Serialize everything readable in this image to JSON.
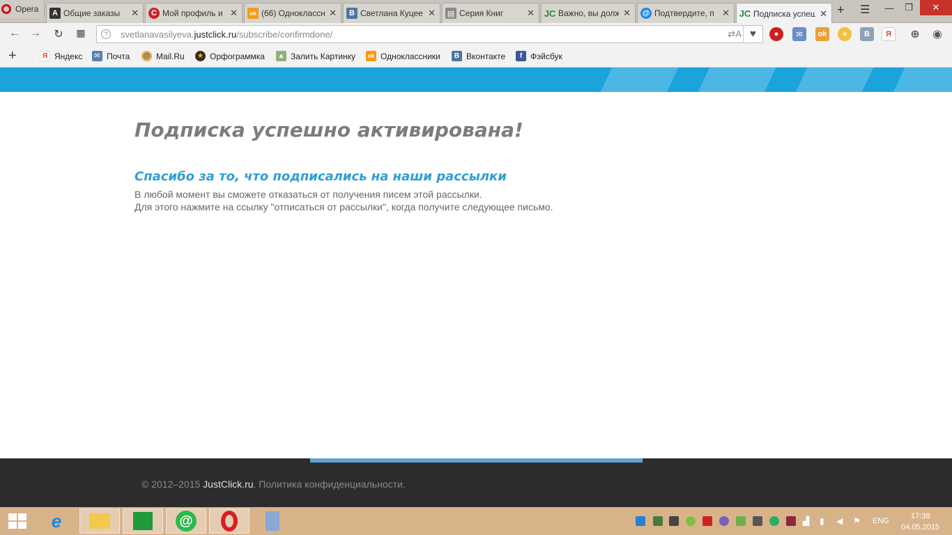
{
  "browser": {
    "menu_label": "Opera",
    "tabs": [
      {
        "title": "Общие заказы",
        "icon_text": "A",
        "icon_color": "#333333"
      },
      {
        "title": "Мой профиль и",
        "icon_text": "С",
        "icon_color": "#cc2222"
      },
      {
        "title": "(66) Одноклассн",
        "icon_text": "ok",
        "icon_color": "#f39c12"
      },
      {
        "title": "Светлана Куцее",
        "icon_text": "B",
        "icon_color": "#4c75a3"
      },
      {
        "title": "Серия Книг",
        "icon_text": "▤",
        "icon_color": "#888888"
      },
      {
        "title": "Важно, вы долж",
        "icon_text": "JC",
        "icon_color": "#2a8a3a"
      },
      {
        "title": "Подтвердите, п",
        "icon_text": "@",
        "icon_color": "#1e88e5"
      },
      {
        "title": "Подписка успеш",
        "icon_text": "JC",
        "icon_color": "#2a8a3a",
        "active": true
      }
    ],
    "new_tab": "+",
    "url_plain_start": "svetlanavasilyeva.",
    "url_domain": "justclick.ru",
    "url_path": "/subscribe/confirmdone/",
    "translate_label": "⇄A",
    "bookmarks": [
      {
        "label": "Яндекс",
        "icon_text": "Я",
        "icon_color": "#e53935"
      },
      {
        "label": "Почта",
        "icon_text": "✉",
        "icon_color": "#5a7fb0"
      },
      {
        "label": "Mail.Ru",
        "icon_text": "@",
        "icon_color": "#1565c0"
      },
      {
        "label": "Орфограммка",
        "icon_text": "★",
        "icon_color": "#3a2a1a"
      },
      {
        "label": "Залить Картинку",
        "icon_text": "▲",
        "icon_color": "#4a7a3a"
      },
      {
        "label": "Одноклассники",
        "icon_text": "ok",
        "icon_color": "#f39c12"
      },
      {
        "label": "Вконтакте",
        "icon_text": "B",
        "icon_color": "#4c75a3"
      },
      {
        "label": "Фэйсбук",
        "icon_text": "f",
        "icon_color": "#3b5998"
      }
    ]
  },
  "page": {
    "heading": "Подписка успешно активирована!",
    "subheading": "Спасибо за то, что подписались на наши рассылки",
    "line1": "В любой момент вы сможете отказаться от получения писем этой рассылки.",
    "line2": "Для этого нажмите на ссылку \"отписаться от рассылки\", когда получите следующее письмо.",
    "footer_copy": "© 2012–2015 ",
    "footer_brand": "JustClick.ru",
    "footer_rest": ". Политика конфиденциальности.",
    "accent_color": "#1ba3dc"
  },
  "taskbar": {
    "lang": "ENG",
    "time": "17:38",
    "date": "04.05.2015"
  }
}
